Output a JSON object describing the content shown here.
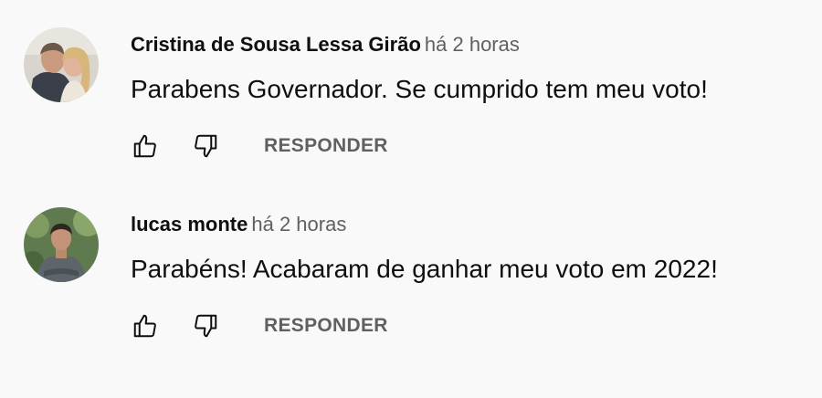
{
  "comments": [
    {
      "author": "Cristina de Sousa Lessa Girão",
      "time": "há 2 horas",
      "text": "Parabens Governador. Se cumprido tem meu voto!",
      "like_icon": "thumb-up-icon",
      "dislike_icon": "thumb-down-icon",
      "reply_label": "RESPONDER"
    },
    {
      "author": "lucas monte",
      "time": "há 2 horas",
      "text": "Parabéns! Acabaram de ganhar meu voto em 2022!",
      "like_icon": "thumb-up-icon",
      "dislike_icon": "thumb-down-icon",
      "reply_label": "RESPONDER"
    }
  ],
  "colors": {
    "background": "#f9f9f9",
    "primary_text": "#0f0f0f",
    "secondary_text": "#606060"
  }
}
